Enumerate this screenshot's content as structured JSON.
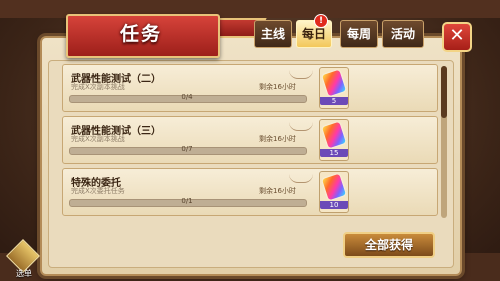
{
  "title": "任务",
  "tabs": [
    {
      "label": "主线",
      "active": false
    },
    {
      "label": "每日",
      "active": true
    },
    {
      "label": "每周",
      "active": false
    },
    {
      "label": "活动",
      "active": false
    }
  ],
  "badge": "!",
  "close_symbol": "✕",
  "quests": [
    {
      "title": "武器性能测试（二）",
      "desc": "完成X次副本挑战",
      "remaining": "剩余16小时",
      "progress_text": "0/4",
      "progress": 0,
      "reward_count": "5"
    },
    {
      "title": "武器性能测试（三）",
      "desc": "完成X次副本挑战",
      "remaining": "剩余16小时",
      "progress_text": "0/7",
      "progress": 0,
      "reward_count": "15"
    },
    {
      "title": "特殊的委托",
      "desc": "完成X次委托任务",
      "remaining": "剩余16小时",
      "progress_text": "0/1",
      "progress": 0,
      "reward_count": "10"
    }
  ],
  "claim_all": "全部获得",
  "menu_label": "选单",
  "scroll_position": 0.0
}
